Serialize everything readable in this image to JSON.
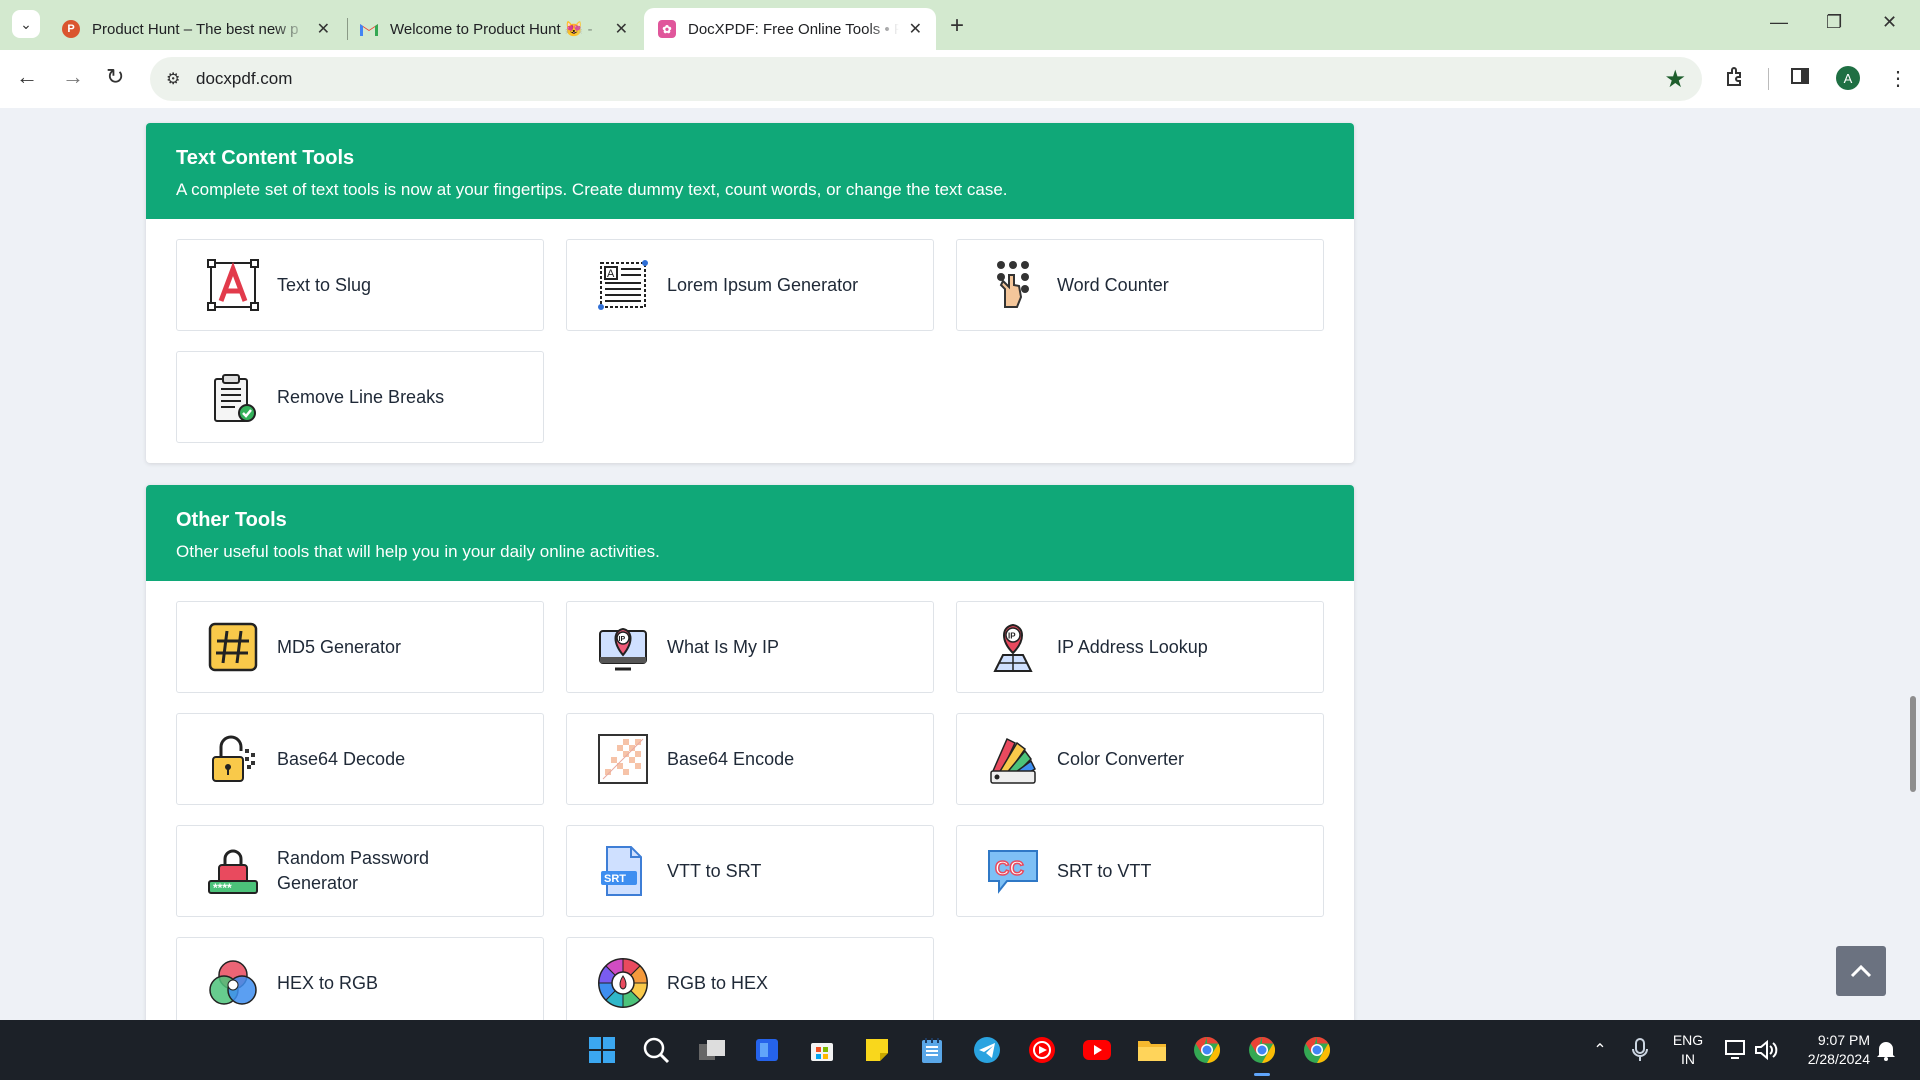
{
  "browser": {
    "tabs": [
      {
        "title": "Product Hunt – The best new p",
        "favicon": "product-hunt-icon",
        "active": false
      },
      {
        "title": "Welcome to Product Hunt 😻 -",
        "favicon": "gmail-icon",
        "active": false
      },
      {
        "title": "DocXPDF: Free Online Tools • Fr",
        "favicon": "docxpdf-icon",
        "active": true
      }
    ],
    "url": "docxpdf.com"
  },
  "sections": [
    {
      "title": "Text Content Tools",
      "description": "A complete set of text tools is now at your fingertips. Create dummy text, count words, or change the text case.",
      "tools": [
        {
          "label": "Text to Slug",
          "icon": "text-slug-icon"
        },
        {
          "label": "Lorem Ipsum Generator",
          "icon": "lorem-ipsum-icon"
        },
        {
          "label": "Word Counter",
          "icon": "word-counter-icon"
        },
        {
          "label": "Remove Line Breaks",
          "icon": "clipboard-check-icon"
        }
      ]
    },
    {
      "title": "Other Tools",
      "description": "Other useful tools that will help you in your daily online activities.",
      "tools": [
        {
          "label": "MD5 Generator",
          "icon": "hash-icon"
        },
        {
          "label": "What Is My IP",
          "icon": "monitor-ip-icon"
        },
        {
          "label": "IP Address Lookup",
          "icon": "ip-location-icon"
        },
        {
          "label": "Base64 Decode",
          "icon": "padlock-open-icon"
        },
        {
          "label": "Base64 Encode",
          "icon": "checker-image-icon"
        },
        {
          "label": "Color Converter",
          "icon": "color-swatch-icon"
        },
        {
          "label": "Random Password Generator",
          "icon": "password-lock-icon"
        },
        {
          "label": "VTT to SRT",
          "icon": "srt-file-icon"
        },
        {
          "label": "SRT to VTT",
          "icon": "cc-bubble-icon"
        },
        {
          "label": "HEX to RGB",
          "icon": "rgb-circles-icon"
        },
        {
          "label": "RGB to HEX",
          "icon": "color-wheel-icon"
        }
      ]
    }
  ],
  "taskbar": {
    "language": "ENG",
    "region": "IN",
    "time": "9:07 PM",
    "date": "2/28/2024"
  },
  "colors": {
    "section_header": "#10a878",
    "tab_strip": "#d3e9cf",
    "taskbar": "#1c2128"
  }
}
